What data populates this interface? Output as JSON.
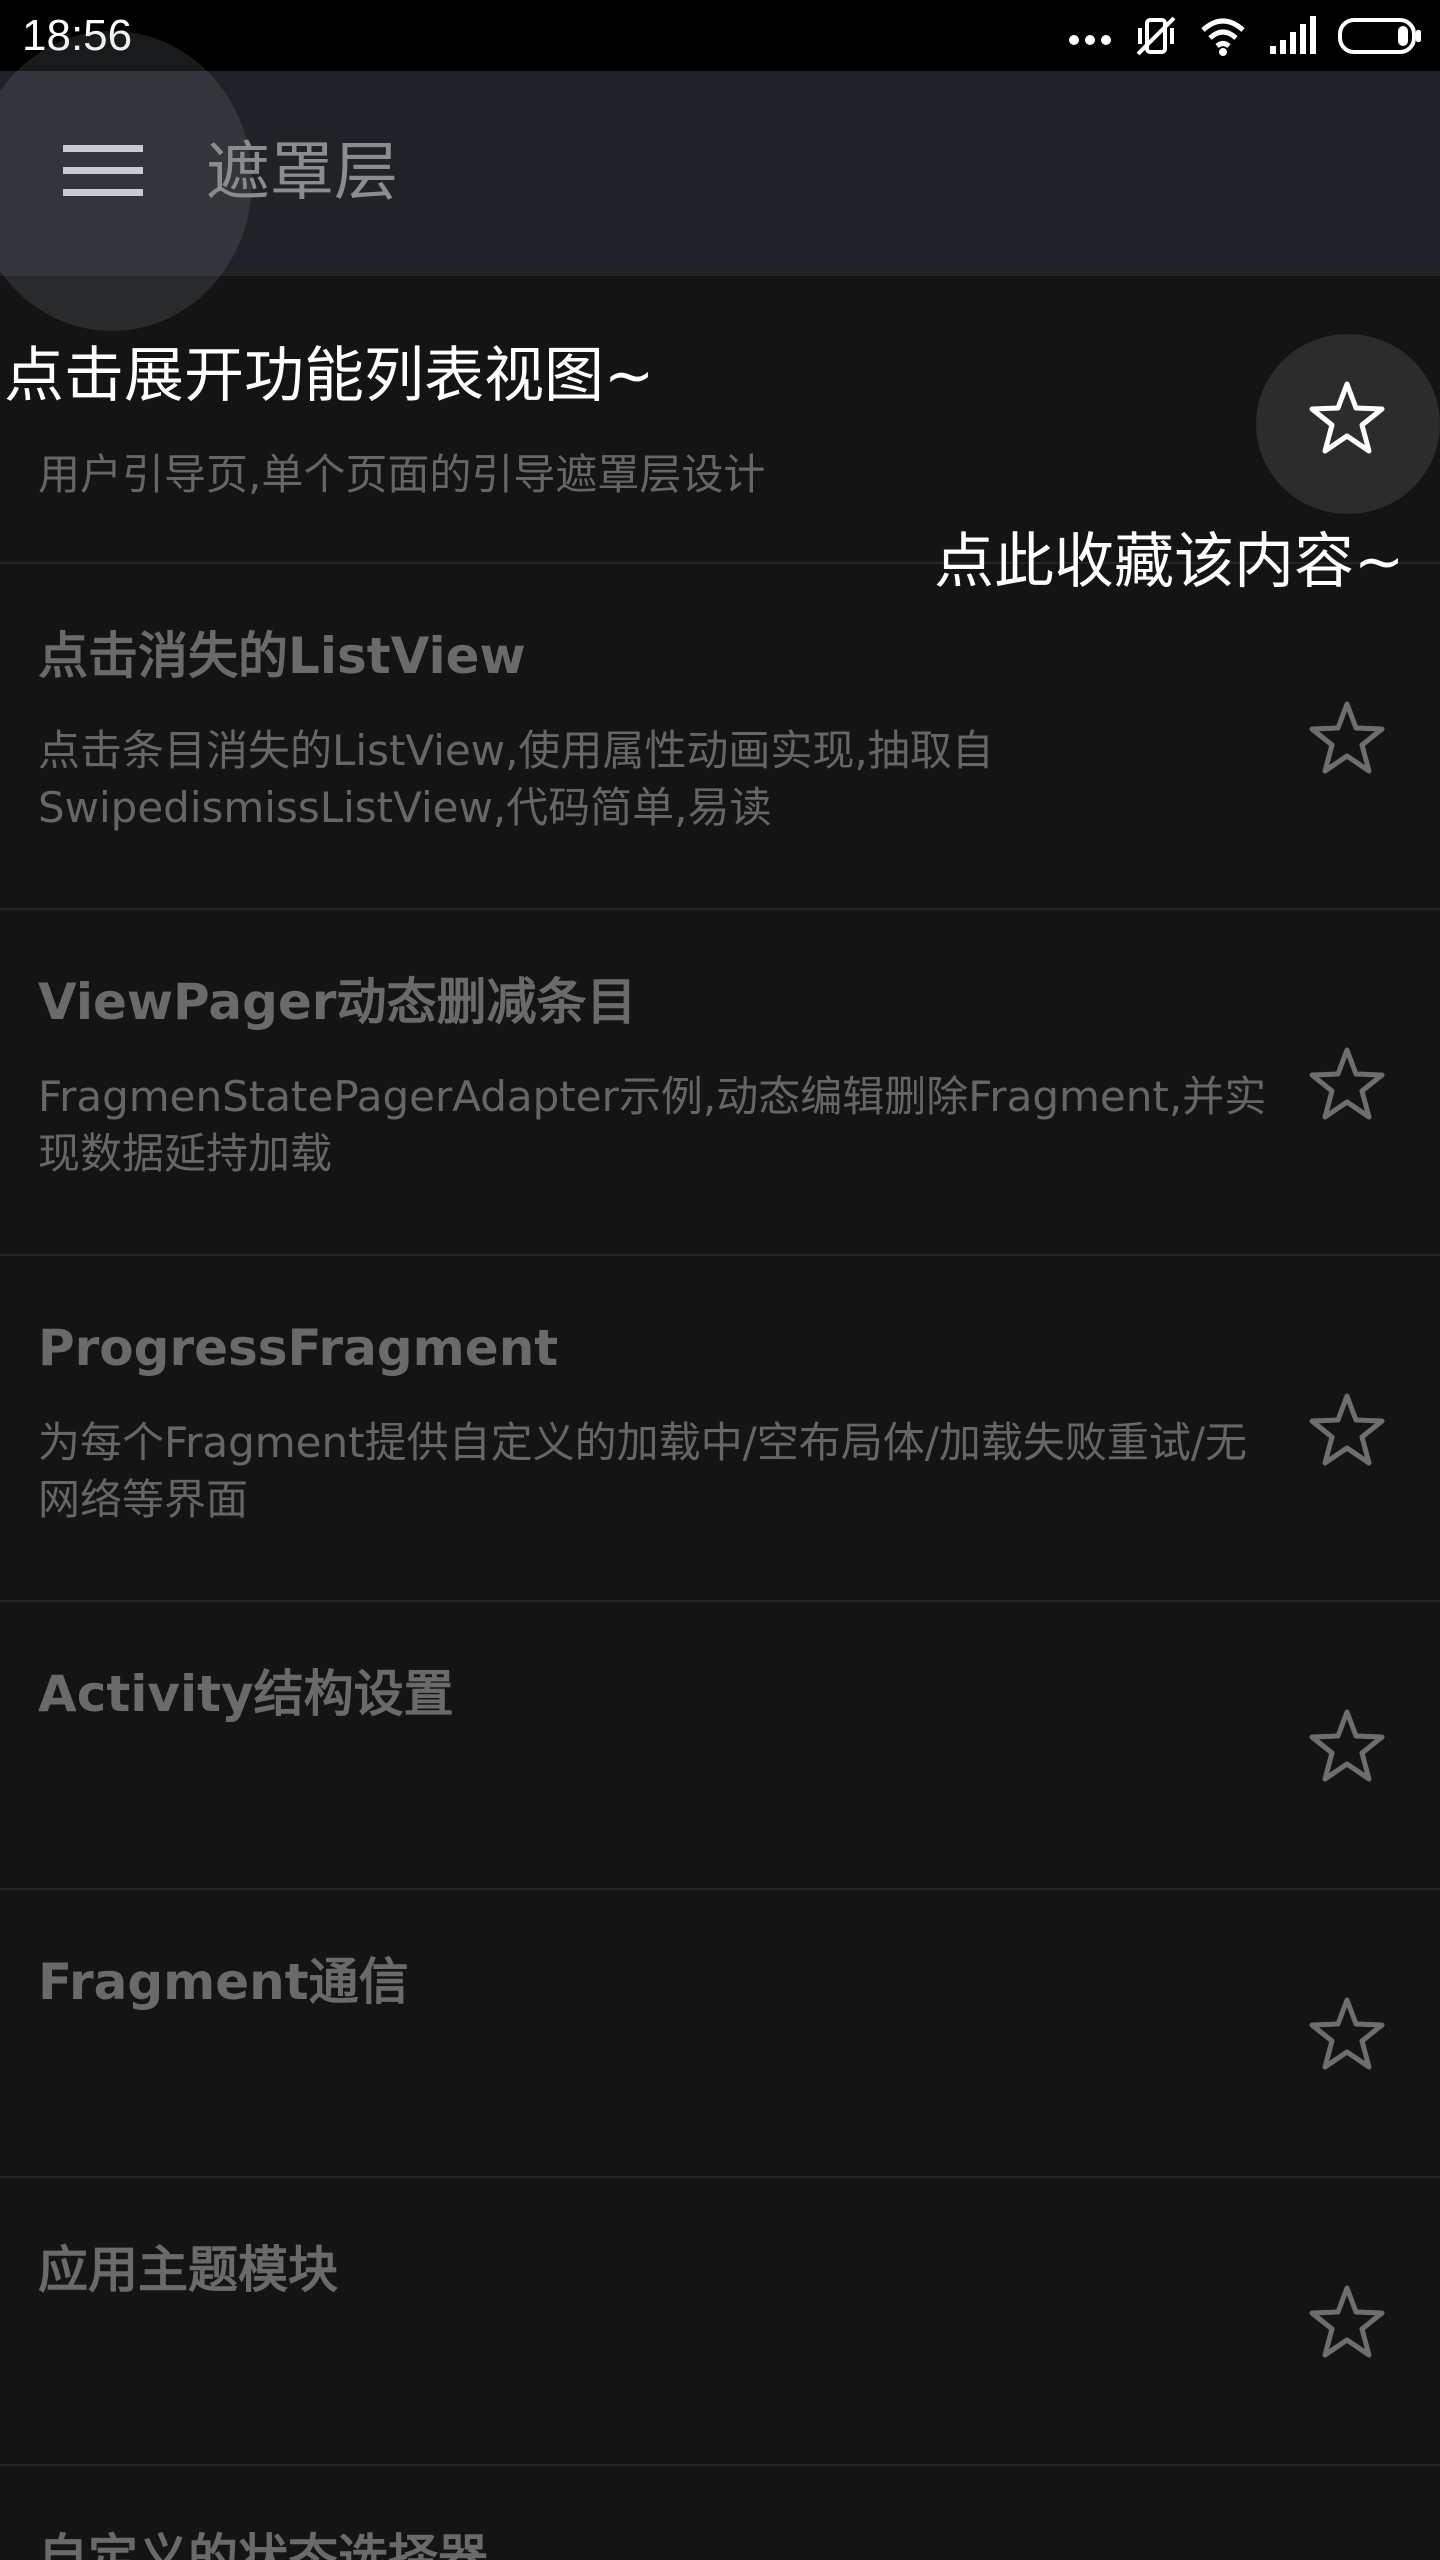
{
  "status_bar": {
    "time": "18:56",
    "icons": [
      "more-dots-icon",
      "vibrate-icon",
      "wifi-icon",
      "signal-icon",
      "battery-icon"
    ]
  },
  "app_bar": {
    "title": "遮罩层",
    "menu_icon": "hamburger-menu-icon"
  },
  "overlay": {
    "menu_hint": "点击展开功能列表视图~",
    "favorite_hint": "点此收藏该内容~"
  },
  "list": {
    "items": [
      {
        "title": "",
        "description": "用户引导页,单个页面的引导遮罩层设计",
        "starred": false
      },
      {
        "title": "点击消失的ListView",
        "description": "点击条目消失的ListView,使用属性动画实现,抽取自SwipedismissListView,代码简单,易读",
        "starred": false
      },
      {
        "title": "ViewPager动态删减条目",
        "description": "FragmenStatePagerAdapter示例,动态编辑删除Fragment,并实现数据延持加载",
        "starred": false
      },
      {
        "title": "ProgressFragment",
        "description": "为每个Fragment提供自定义的加载中/空布局体/加载失败重试/无网络等界面",
        "starred": false
      },
      {
        "title": "Activity结构设置",
        "description": "",
        "starred": false
      },
      {
        "title": "Fragment通信",
        "description": "",
        "starred": false
      },
      {
        "title": "应用主题模块",
        "description": "",
        "starred": false
      },
      {
        "title": "自定义的状态选择器",
        "description": "",
        "starred": false
      }
    ]
  },
  "colors": {
    "background": "#141414",
    "app_bar": "#1f2226",
    "title_text": "#6a6a6a",
    "desc_text": "#666666",
    "hint_text": "#ffffff"
  }
}
